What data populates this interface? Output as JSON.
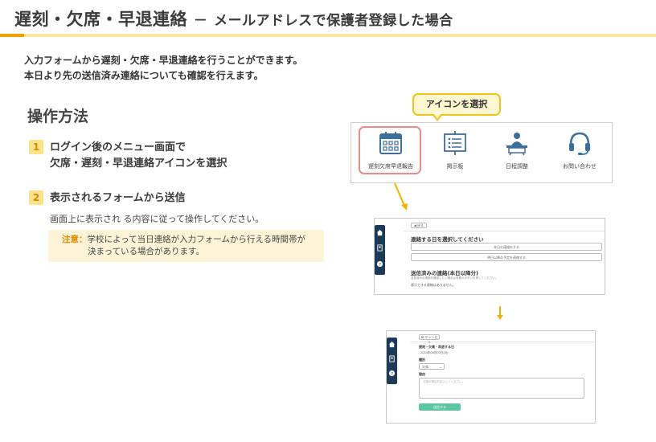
{
  "header": {
    "title_main": "遅刻・欠席・早退連絡",
    "title_sep": "－",
    "title_sub": "メールアドレスで保護者登録した場合"
  },
  "intro": {
    "line1": "入力フォームから遅刻・欠席・早退連絡を行うことができます。",
    "line2": "本日より先の送信済み連絡についても確認を行えます。"
  },
  "section_title": "操作方法",
  "steps": [
    {
      "num": "1",
      "line1": "ログイン後のメニュー画面で",
      "line2": "欠席・遅刻・早退連絡アイコンを選択"
    },
    {
      "num": "2",
      "line1": "表示されるフォームから送信",
      "desc": "画面上に表示され る内容に従って操作してください。"
    }
  ],
  "note": {
    "label": "注意：",
    "line1": "学校によって当日連絡が入力フォームから行える時間帯が",
    "line2": "決まっている場合があります。"
  },
  "callout": "アイコンを選択",
  "menu": {
    "items": [
      {
        "label": "遅刻欠席早退報告",
        "icon": "calendar-icon"
      },
      {
        "label": "掲示板",
        "icon": "bulletin-board-icon"
      },
      {
        "label": "日程調整",
        "icon": "schedule-meeting-icon"
      },
      {
        "label": "お問い合わせ",
        "icon": "headset-icon"
      }
    ]
  },
  "shot1": {
    "back": "◀ 戻る",
    "select_day": "連絡する日を選択してください",
    "btn_today": "本日の連絡をする",
    "btn_future": "明日以降の予定を連絡する",
    "sent_title": "送信済みの連絡(本日以降分)",
    "sent_desc": "送信済みの連絡を確認したい場合は対象のボタンを押してください。",
    "none": "表示できる連絡はありません。",
    "nav": [
      "ホーム",
      "",
      "ヘルプ"
    ]
  },
  "shot2": {
    "cancel": "✖ キャンセル",
    "field_label": "遅刻・欠席・早退する日",
    "date_value": "2024年06月03日(月)",
    "type_label": "種別",
    "type_value": "欠席",
    "reason_label": "理由",
    "reason_placeholder": "欠席の理由を記入してください。",
    "submit": "送信する"
  },
  "colors": {
    "accent_orange": "#f0a100",
    "header_line": "#fbe79a",
    "step_badge": "#fce38a",
    "note_bg": "#fdf4d8",
    "highlight": "#ef8a8a",
    "icon_blue": "#3d6f9c",
    "nav_dark": "#1d3a56",
    "submit_green": "#5cc6a0"
  }
}
